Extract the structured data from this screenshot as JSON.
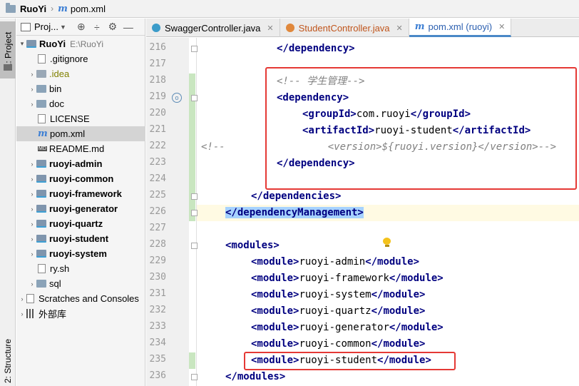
{
  "breadcrumb": {
    "project": "RuoYi",
    "file": "pom.xml"
  },
  "tool_strip": {
    "project_tab": "1: Project",
    "structure_tab": "2: Structure"
  },
  "project_panel": {
    "title": "Proj...",
    "tree": [
      {
        "label": "RuoYi",
        "extra": "E:\\RuoYi",
        "type": "module-root"
      },
      {
        "label": ".gitignore",
        "type": "file"
      },
      {
        "label": ".idea",
        "type": "folder"
      },
      {
        "label": "bin",
        "type": "folder"
      },
      {
        "label": "doc",
        "type": "folder"
      },
      {
        "label": "LICENSE",
        "type": "file"
      },
      {
        "label": "pom.xml",
        "type": "maven"
      },
      {
        "label": "README.md",
        "type": "md"
      },
      {
        "label": "ruoyi-admin",
        "type": "module"
      },
      {
        "label": "ruoyi-common",
        "type": "module"
      },
      {
        "label": "ruoyi-framework",
        "type": "module"
      },
      {
        "label": "ruoyi-generator",
        "type": "module"
      },
      {
        "label": "ruoyi-quartz",
        "type": "module"
      },
      {
        "label": "ruoyi-student",
        "type": "module"
      },
      {
        "label": "ruoyi-system",
        "type": "module"
      },
      {
        "label": "ry.sh",
        "type": "file"
      },
      {
        "label": "sql",
        "type": "folder"
      },
      {
        "label": "Scratches and Consoles",
        "type": "scratches"
      },
      {
        "label": "外部库",
        "type": "libraries"
      }
    ]
  },
  "tabs": [
    {
      "label": "SwaggerController.java",
      "icon": "class-icon"
    },
    {
      "label": "StudentController.java",
      "icon": "class-icon"
    },
    {
      "label": "pom.xml (ruoyi)",
      "icon": "maven-icon"
    }
  ],
  "editor": {
    "lines": [
      {
        "num": "216",
        "tokens": [
          [
            "t",
            "</dependency>"
          ]
        ]
      },
      {
        "num": "217",
        "tokens": []
      },
      {
        "num": "218",
        "tokens": [
          [
            "cm",
            "<!-- 学生管理-->"
          ]
        ]
      },
      {
        "num": "219",
        "tokens": [
          [
            "t",
            "<dependency>"
          ]
        ]
      },
      {
        "num": "220",
        "tokens": [
          [
            "t",
            "<groupId>"
          ],
          [
            "pl",
            "com.ruoyi"
          ],
          [
            "t",
            "</groupId>"
          ]
        ]
      },
      {
        "num": "221",
        "tokens": [
          [
            "t",
            "<artifactId>"
          ],
          [
            "pl",
            "ruoyi-student"
          ],
          [
            "t",
            "</artifactId>"
          ]
        ]
      },
      {
        "num": "222",
        "tokens": [
          [
            "cm",
            "<version>${ruoyi.version}</version>-->"
          ]
        ],
        "prefix": "<!--"
      },
      {
        "num": "223",
        "tokens": [
          [
            "t",
            "</dependency>"
          ]
        ]
      },
      {
        "num": "224",
        "tokens": []
      },
      {
        "num": "225",
        "tokens": [
          [
            "t",
            "</dependencies>"
          ]
        ]
      },
      {
        "num": "226",
        "tokens": [
          [
            "sel",
            "</dependencyManagement>"
          ]
        ]
      },
      {
        "num": "227",
        "tokens": []
      },
      {
        "num": "228",
        "tokens": [
          [
            "t",
            "<modules>"
          ]
        ]
      },
      {
        "num": "229",
        "tokens": [
          [
            "t",
            "<module>"
          ],
          [
            "pl",
            "ruoyi-admin"
          ],
          [
            "t",
            "</module>"
          ]
        ]
      },
      {
        "num": "230",
        "tokens": [
          [
            "t",
            "<module>"
          ],
          [
            "pl",
            "ruoyi-framework"
          ],
          [
            "t",
            "</module>"
          ]
        ]
      },
      {
        "num": "231",
        "tokens": [
          [
            "t",
            "<module>"
          ],
          [
            "pl",
            "ruoyi-system"
          ],
          [
            "t",
            "</module>"
          ]
        ]
      },
      {
        "num": "232",
        "tokens": [
          [
            "t",
            "<module>"
          ],
          [
            "pl",
            "ruoyi-quartz"
          ],
          [
            "t",
            "</module>"
          ]
        ]
      },
      {
        "num": "233",
        "tokens": [
          [
            "t",
            "<module>"
          ],
          [
            "pl",
            "ruoyi-generator"
          ],
          [
            "t",
            "</module>"
          ]
        ]
      },
      {
        "num": "234",
        "tokens": [
          [
            "t",
            "<module>"
          ],
          [
            "pl",
            "ruoyi-common"
          ],
          [
            "t",
            "</module>"
          ]
        ]
      },
      {
        "num": "235",
        "tokens": [
          [
            "t",
            "<module>"
          ],
          [
            "pl",
            "ruoyi-student"
          ],
          [
            "t",
            "</module>"
          ]
        ]
      },
      {
        "num": "236",
        "tokens": [
          [
            "t",
            "</modules>"
          ]
        ]
      }
    ]
  },
  "colors": {
    "highlight_red": "#e53935",
    "selection": "#a6d2ff",
    "tag": "#000080",
    "comment": "#808080"
  }
}
